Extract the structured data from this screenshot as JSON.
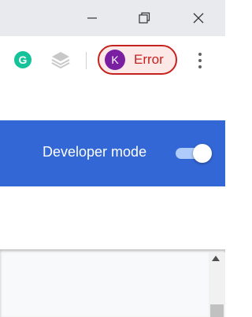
{
  "window": {
    "minimize_icon": "minimize-icon",
    "restore_icon": "restore-icon",
    "close_icon": "close-icon"
  },
  "toolbar": {
    "grammarly_letter": "G",
    "extensions": [
      "grammarly-icon",
      "layers-icon"
    ],
    "profile": {
      "avatar_initial": "K",
      "status": "Error",
      "accent": "#c5221f",
      "avatar_color": "#7b1fa2"
    },
    "menu_icon": "kebab-menu-icon"
  },
  "banner": {
    "color": "#3367d6",
    "developer_mode_label": "Developer mode",
    "developer_mode_enabled": true
  }
}
